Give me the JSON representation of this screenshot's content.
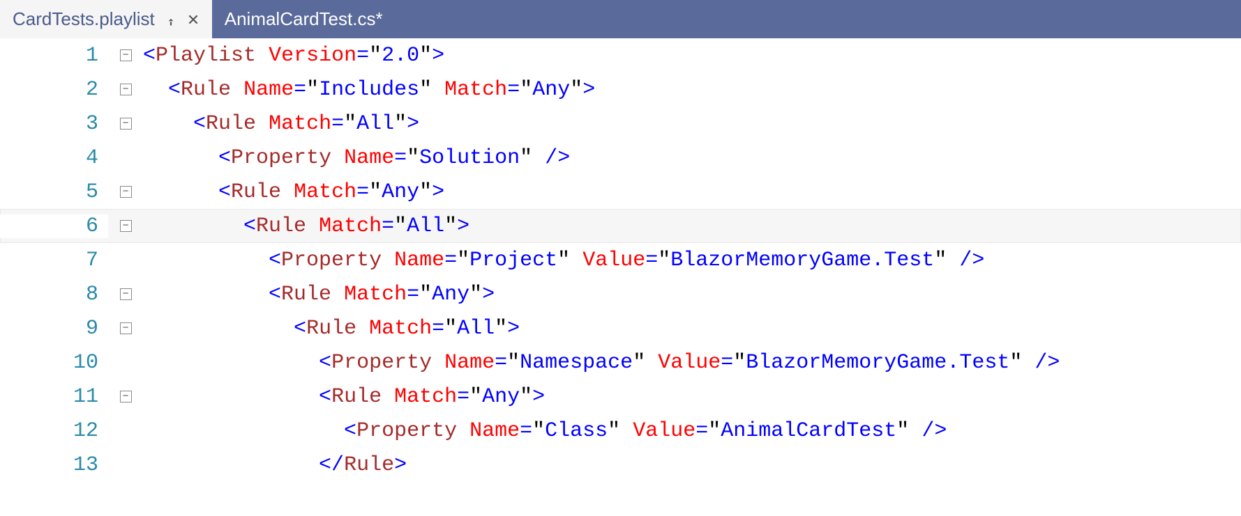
{
  "tabs": [
    {
      "label": "CardTests.playlist",
      "active": true,
      "pinned": true,
      "closable": true
    },
    {
      "label": "AnimalCardTest.cs*",
      "active": false
    }
  ],
  "code": {
    "lines": [
      {
        "num": "1",
        "fold": "minus",
        "indent": 0,
        "tokens": [
          {
            "c": "blue",
            "t": "<"
          },
          {
            "c": "maroon",
            "t": "Playlist"
          },
          {
            "c": "blue",
            "t": " "
          },
          {
            "c": "red",
            "t": "Version"
          },
          {
            "c": "blue",
            "t": "="
          },
          {
            "c": "black",
            "t": "\""
          },
          {
            "c": "blue",
            "t": "2.0"
          },
          {
            "c": "black",
            "t": "\""
          },
          {
            "c": "blue",
            "t": ">"
          }
        ]
      },
      {
        "num": "2",
        "fold": "minus",
        "indent": 1,
        "tokens": [
          {
            "c": "blue",
            "t": "<"
          },
          {
            "c": "maroon",
            "t": "Rule"
          },
          {
            "c": "blue",
            "t": " "
          },
          {
            "c": "red",
            "t": "Name"
          },
          {
            "c": "blue",
            "t": "="
          },
          {
            "c": "black",
            "t": "\""
          },
          {
            "c": "blue",
            "t": "Includes"
          },
          {
            "c": "black",
            "t": "\""
          },
          {
            "c": "blue",
            "t": " "
          },
          {
            "c": "red",
            "t": "Match"
          },
          {
            "c": "blue",
            "t": "="
          },
          {
            "c": "black",
            "t": "\""
          },
          {
            "c": "blue",
            "t": "Any"
          },
          {
            "c": "black",
            "t": "\""
          },
          {
            "c": "blue",
            "t": ">"
          }
        ]
      },
      {
        "num": "3",
        "fold": "minus",
        "indent": 2,
        "tokens": [
          {
            "c": "blue",
            "t": "<"
          },
          {
            "c": "maroon",
            "t": "Rule"
          },
          {
            "c": "blue",
            "t": " "
          },
          {
            "c": "red",
            "t": "Match"
          },
          {
            "c": "blue",
            "t": "="
          },
          {
            "c": "black",
            "t": "\""
          },
          {
            "c": "blue",
            "t": "All"
          },
          {
            "c": "black",
            "t": "\""
          },
          {
            "c": "blue",
            "t": ">"
          }
        ]
      },
      {
        "num": "4",
        "fold": "line",
        "indent": 3,
        "tokens": [
          {
            "c": "blue",
            "t": "<"
          },
          {
            "c": "maroon",
            "t": "Property"
          },
          {
            "c": "blue",
            "t": " "
          },
          {
            "c": "red",
            "t": "Name"
          },
          {
            "c": "blue",
            "t": "="
          },
          {
            "c": "black",
            "t": "\""
          },
          {
            "c": "blue",
            "t": "Solution"
          },
          {
            "c": "black",
            "t": "\""
          },
          {
            "c": "blue",
            "t": " />"
          }
        ]
      },
      {
        "num": "5",
        "fold": "minus",
        "indent": 3,
        "tokens": [
          {
            "c": "blue",
            "t": "<"
          },
          {
            "c": "maroon",
            "t": "Rule"
          },
          {
            "c": "blue",
            "t": " "
          },
          {
            "c": "red",
            "t": "Match"
          },
          {
            "c": "blue",
            "t": "="
          },
          {
            "c": "black",
            "t": "\""
          },
          {
            "c": "blue",
            "t": "Any"
          },
          {
            "c": "black",
            "t": "\""
          },
          {
            "c": "blue",
            "t": ">"
          }
        ]
      },
      {
        "num": "6",
        "fold": "minus",
        "indent": 4,
        "current": true,
        "tokens": [
          {
            "c": "blue",
            "t": "<"
          },
          {
            "c": "maroon",
            "t": "Rule"
          },
          {
            "c": "blue",
            "t": " "
          },
          {
            "c": "red",
            "t": "Match"
          },
          {
            "c": "blue",
            "t": "="
          },
          {
            "c": "black",
            "t": "\""
          },
          {
            "c": "blue",
            "t": "All"
          },
          {
            "c": "black",
            "t": "\""
          },
          {
            "c": "blue",
            "t": ">"
          }
        ]
      },
      {
        "num": "7",
        "fold": "line",
        "indent": 5,
        "tokens": [
          {
            "c": "blue",
            "t": "<"
          },
          {
            "c": "maroon",
            "t": "Property"
          },
          {
            "c": "blue",
            "t": " "
          },
          {
            "c": "red",
            "t": "Name"
          },
          {
            "c": "blue",
            "t": "="
          },
          {
            "c": "black",
            "t": "\""
          },
          {
            "c": "blue",
            "t": "Project"
          },
          {
            "c": "black",
            "t": "\""
          },
          {
            "c": "blue",
            "t": " "
          },
          {
            "c": "red",
            "t": "Value"
          },
          {
            "c": "blue",
            "t": "="
          },
          {
            "c": "black",
            "t": "\""
          },
          {
            "c": "blue",
            "t": "BlazorMemoryGame.Test"
          },
          {
            "c": "black",
            "t": "\""
          },
          {
            "c": "blue",
            "t": " />"
          }
        ]
      },
      {
        "num": "8",
        "fold": "minus",
        "indent": 5,
        "tokens": [
          {
            "c": "blue",
            "t": "<"
          },
          {
            "c": "maroon",
            "t": "Rule"
          },
          {
            "c": "blue",
            "t": " "
          },
          {
            "c": "red",
            "t": "Match"
          },
          {
            "c": "blue",
            "t": "="
          },
          {
            "c": "black",
            "t": "\""
          },
          {
            "c": "blue",
            "t": "Any"
          },
          {
            "c": "black",
            "t": "\""
          },
          {
            "c": "blue",
            "t": ">"
          }
        ]
      },
      {
        "num": "9",
        "fold": "minus",
        "indent": 6,
        "tokens": [
          {
            "c": "blue",
            "t": "<"
          },
          {
            "c": "maroon",
            "t": "Rule"
          },
          {
            "c": "blue",
            "t": " "
          },
          {
            "c": "red",
            "t": "Match"
          },
          {
            "c": "blue",
            "t": "="
          },
          {
            "c": "black",
            "t": "\""
          },
          {
            "c": "blue",
            "t": "All"
          },
          {
            "c": "black",
            "t": "\""
          },
          {
            "c": "blue",
            "t": ">"
          }
        ]
      },
      {
        "num": "10",
        "fold": "line",
        "indent": 7,
        "tokens": [
          {
            "c": "blue",
            "t": "<"
          },
          {
            "c": "maroon",
            "t": "Property"
          },
          {
            "c": "blue",
            "t": " "
          },
          {
            "c": "red",
            "t": "Name"
          },
          {
            "c": "blue",
            "t": "="
          },
          {
            "c": "black",
            "t": "\""
          },
          {
            "c": "blue",
            "t": "Namespace"
          },
          {
            "c": "black",
            "t": "\""
          },
          {
            "c": "blue",
            "t": " "
          },
          {
            "c": "red",
            "t": "Value"
          },
          {
            "c": "blue",
            "t": "="
          },
          {
            "c": "black",
            "t": "\""
          },
          {
            "c": "blue",
            "t": "BlazorMemoryGame.Test"
          },
          {
            "c": "black",
            "t": "\""
          },
          {
            "c": "blue",
            "t": " />"
          }
        ]
      },
      {
        "num": "11",
        "fold": "minus",
        "indent": 7,
        "tokens": [
          {
            "c": "blue",
            "t": "<"
          },
          {
            "c": "maroon",
            "t": "Rule"
          },
          {
            "c": "blue",
            "t": " "
          },
          {
            "c": "red",
            "t": "Match"
          },
          {
            "c": "blue",
            "t": "="
          },
          {
            "c": "black",
            "t": "\""
          },
          {
            "c": "blue",
            "t": "Any"
          },
          {
            "c": "black",
            "t": "\""
          },
          {
            "c": "blue",
            "t": ">"
          }
        ]
      },
      {
        "num": "12",
        "fold": "line",
        "indent": 8,
        "tokens": [
          {
            "c": "blue",
            "t": "<"
          },
          {
            "c": "maroon",
            "t": "Property"
          },
          {
            "c": "blue",
            "t": " "
          },
          {
            "c": "red",
            "t": "Name"
          },
          {
            "c": "blue",
            "t": "="
          },
          {
            "c": "black",
            "t": "\""
          },
          {
            "c": "blue",
            "t": "Class"
          },
          {
            "c": "black",
            "t": "\""
          },
          {
            "c": "blue",
            "t": " "
          },
          {
            "c": "red",
            "t": "Value"
          },
          {
            "c": "blue",
            "t": "="
          },
          {
            "c": "black",
            "t": "\""
          },
          {
            "c": "blue",
            "t": "AnimalCardTest"
          },
          {
            "c": "black",
            "t": "\""
          },
          {
            "c": "blue",
            "t": " />"
          }
        ]
      },
      {
        "num": "13",
        "fold": "line",
        "indent": 7,
        "tokens": [
          {
            "c": "blue",
            "t": "</"
          },
          {
            "c": "maroon",
            "t": "Rule"
          },
          {
            "c": "blue",
            "t": ">"
          }
        ]
      }
    ]
  }
}
